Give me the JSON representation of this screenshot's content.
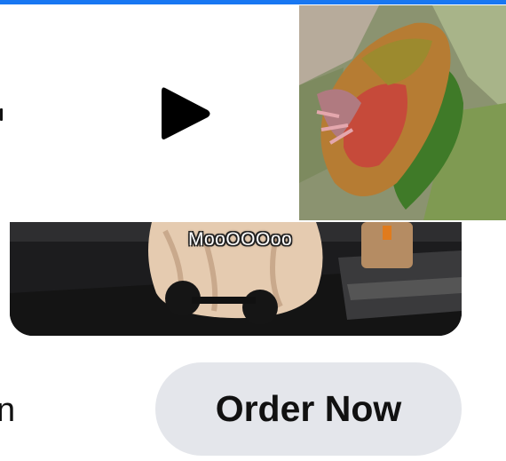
{
  "video": {
    "caption": "MooOOOoo",
    "play_icon": "play-icon"
  },
  "cta": {
    "partial_left_text": "n",
    "order_label": "Order Now"
  },
  "colors": {
    "accent_bar": "#1877f2",
    "button_bg": "#e4e6eb",
    "text": "#111111"
  }
}
